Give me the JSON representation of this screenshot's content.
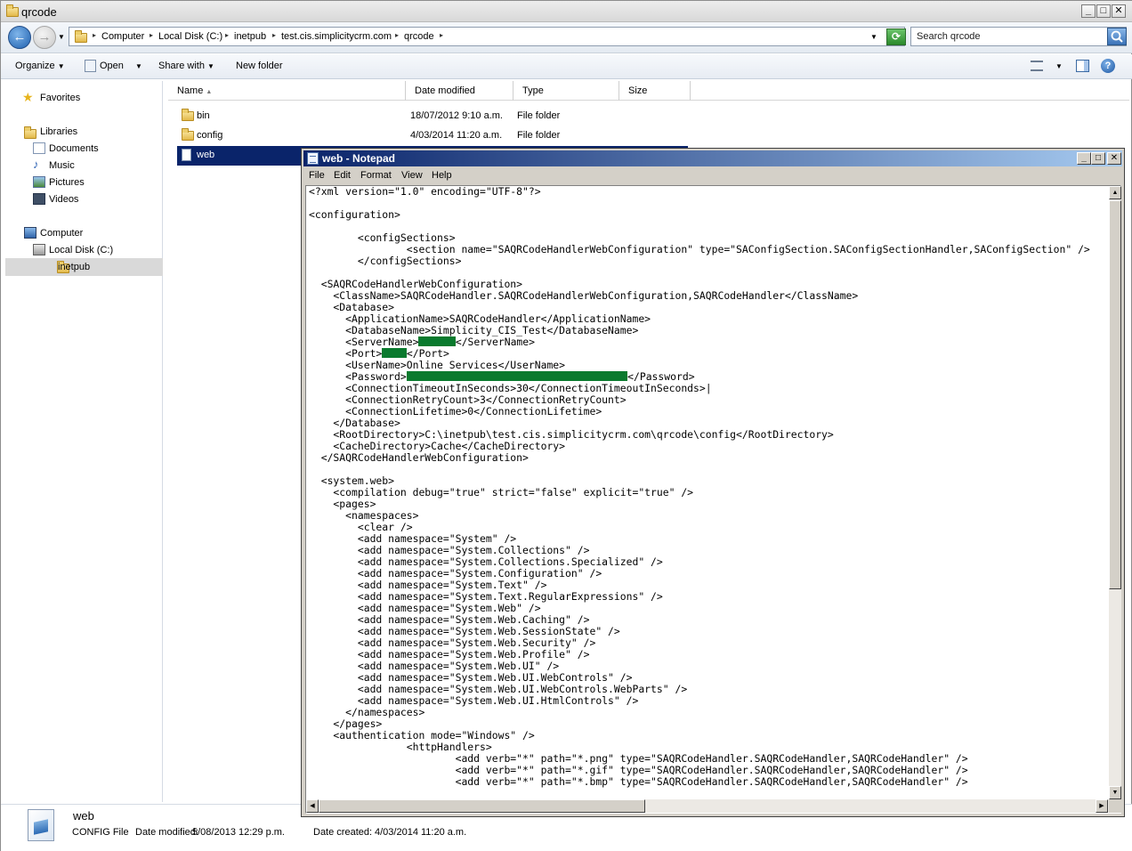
{
  "explorer": {
    "title": "qrcode",
    "breadcrumbs": [
      "Computer",
      "Local Disk (C:)",
      "inetpub",
      "test.cis.simplicitycrm.com",
      "qrcode"
    ],
    "search_placeholder": "Search qrcode",
    "commands": {
      "organize": "Organize",
      "open": "Open",
      "share_with": "Share with",
      "new_folder": "New folder"
    },
    "nav": {
      "favorites": "Favorites",
      "libraries": "Libraries",
      "documents": "Documents",
      "music": "Music",
      "pictures": "Pictures",
      "videos": "Videos",
      "computer": "Computer",
      "local_disk": "Local Disk (C:)",
      "inetpub": "inetpub"
    },
    "columns": {
      "name": "Name",
      "date_modified": "Date modified",
      "type": "Type",
      "size": "Size"
    },
    "files": [
      {
        "name": "bin",
        "date": "18/07/2012 9:10 a.m.",
        "type": "File folder"
      },
      {
        "name": "config",
        "date": "4/03/2014 11:20 a.m.",
        "type": "File folder"
      },
      {
        "name": "web",
        "date": "",
        "type": ""
      }
    ],
    "details": {
      "name": "web",
      "type": "CONFIG File",
      "date_modified_label": "Date modified:",
      "date_modified": "5/08/2013 12:29 p.m.",
      "date_created_label": "Date created:",
      "date_created": "4/03/2014 11:20 a.m."
    }
  },
  "notepad": {
    "title": "web - Notepad",
    "menu": [
      "File",
      "Edit",
      "Format",
      "View",
      "Help"
    ],
    "lines": [
      "<?xml version=\"1.0\" encoding=\"UTF-8\"?>",
      "",
      "<configuration>",
      "",
      "        <configSections>",
      "                <section name=\"SAQRCodeHandlerWebConfiguration\" type=\"SAConfigSection.SAConfigSectionHandler,SAConfigSection\" />",
      "        </configSections>",
      "",
      "  <SAQRCodeHandlerWebConfiguration>",
      "    <ClassName>SAQRCodeHandler.SAQRCodeHandlerWebConfiguration,SAQRCodeHandler</ClassName>",
      "    <Database>",
      "      <ApplicationName>SAQRCodeHandler</ApplicationName>",
      "      <DatabaseName>Simplicity_CIS_Test</DatabaseName>",
      "      <ServerName>",
      "      <Port>",
      "      <UserName>Online Services</UserName>",
      "      <Password>",
      "      <ConnectionTimeoutInSeconds>30</ConnectionTimeoutInSeconds>|",
      "      <ConnectionRetryCount>3</ConnectionRetryCount>",
      "      <ConnectionLifetime>0</ConnectionLifetime>",
      "    </Database>",
      "    <RootDirectory>C:\\inetpub\\test.cis.simplicitycrm.com\\qrcode\\config</RootDirectory>",
      "    <CacheDirectory>Cache</CacheDirectory>",
      "  </SAQRCodeHandlerWebConfiguration>",
      "",
      "  <system.web>",
      "    <compilation debug=\"true\" strict=\"false\" explicit=\"true\" />",
      "    <pages>",
      "      <namespaces>",
      "        <clear />",
      "        <add namespace=\"System\" />",
      "        <add namespace=\"System.Collections\" />",
      "        <add namespace=\"System.Collections.Specialized\" />",
      "        <add namespace=\"System.Configuration\" />",
      "        <add namespace=\"System.Text\" />",
      "        <add namespace=\"System.Text.RegularExpressions\" />",
      "        <add namespace=\"System.Web\" />",
      "        <add namespace=\"System.Web.Caching\" />",
      "        <add namespace=\"System.Web.SessionState\" />",
      "        <add namespace=\"System.Web.Security\" />",
      "        <add namespace=\"System.Web.Profile\" />",
      "        <add namespace=\"System.Web.UI\" />",
      "        <add namespace=\"System.Web.UI.WebControls\" />",
      "        <add namespace=\"System.Web.UI.WebControls.WebParts\" />",
      "        <add namespace=\"System.Web.UI.HtmlControls\" />",
      "      </namespaces>",
      "    </pages>",
      "    <authentication mode=\"Windows\" />",
      "                <httpHandlers>",
      "                        <add verb=\"*\" path=\"*.png\" type=\"SAQRCodeHandler.SAQRCodeHandler,SAQRCodeHandler\" />",
      "                        <add verb=\"*\" path=\"*.gif\" type=\"SAQRCodeHandler.SAQRCodeHandler,SAQRCodeHandler\" />",
      "                        <add verb=\"*\" path=\"*.bmp\" type=\"SAQRCodeHandler.SAQRCodeHandler,SAQRCodeHandler\" />"
    ],
    "redacted_tails": {
      "13": "</ServerName>",
      "14": "</Port>",
      "16": "</Password>"
    },
    "redaction_widths_chars": {
      "13": 6,
      "14": 4,
      "16": 36
    }
  }
}
